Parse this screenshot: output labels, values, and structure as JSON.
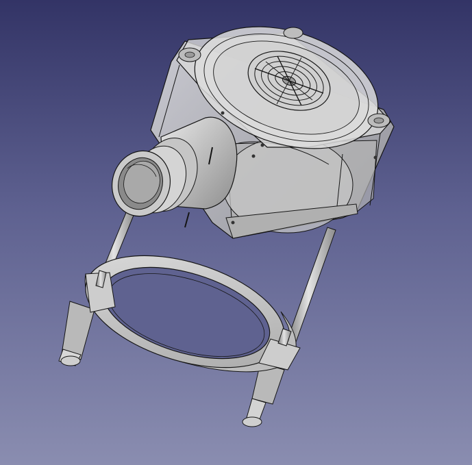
{
  "viewport": {
    "background_top": "#333466",
    "background_bottom": "#8a8db0",
    "mode": "3d-cad-view"
  },
  "model": {
    "parts": [
      "fan-housing",
      "intake-nozzle",
      "support-rod-left",
      "support-rod-right",
      "clamp-ring",
      "fan-grille"
    ],
    "body_color": "#c8c8c8",
    "edge_color": "#141414"
  }
}
